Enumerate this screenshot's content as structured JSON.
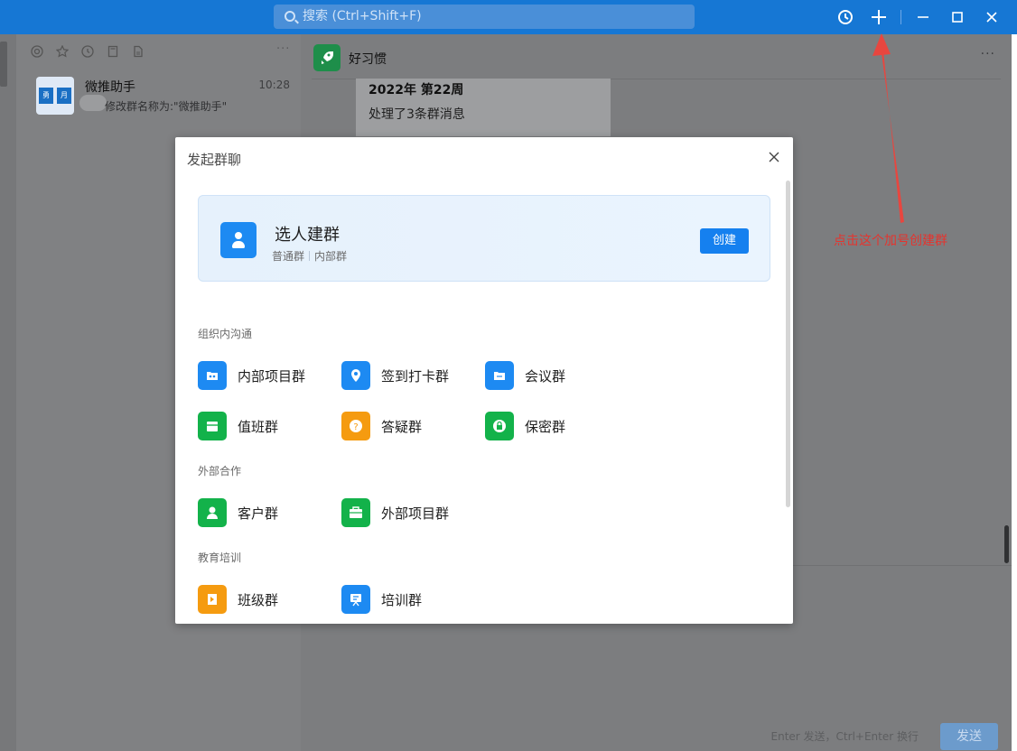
{
  "search": {
    "placeholder": "搜索 (Ctrl+Shift+F)"
  },
  "topbar_icons": [
    "history-icon",
    "plus-icon",
    "minimize-icon",
    "maximize-icon",
    "close-icon"
  ],
  "conversation_tabs": [
    "at-icon",
    "star-icon",
    "clock-icon",
    "bookmark-icon",
    "file-icon"
  ],
  "conversation": {
    "avatar_text": [
      "勇",
      "月"
    ],
    "name": "微推助手",
    "time": "10:28",
    "preview": "修改群名称为:\"微推助手\""
  },
  "chat": {
    "title": "好习惯",
    "card_title": "2022年 第22周",
    "card_body": "处理了3条群消息",
    "input_hint": "Enter 发送，Ctrl+Enter 换行",
    "send_label": "发送"
  },
  "annotation": "点击这个加号创建群",
  "modal": {
    "title": "发起群聊",
    "hero": {
      "title": "选人建群",
      "tag1": "普通群",
      "tag2": "内部群",
      "button": "创建"
    },
    "sections": [
      {
        "label": "组织内沟通",
        "items": [
          {
            "label": "内部项目群",
            "color": "#1d8af2",
            "icon": "folder-people-icon"
          },
          {
            "label": "签到打卡群",
            "color": "#1d8af2",
            "icon": "location-pin-icon"
          },
          {
            "label": "会议群",
            "color": "#1d8af2",
            "icon": "folder-icon"
          },
          {
            "label": "值班群",
            "color": "#13b24a",
            "icon": "calendar-icon"
          },
          {
            "label": "答疑群",
            "color": "#f59b10",
            "icon": "question-icon"
          },
          {
            "label": "保密群",
            "color": "#13b24a",
            "icon": "lock-icon"
          }
        ]
      },
      {
        "label": "外部合作",
        "items": [
          {
            "label": "客户群",
            "color": "#13b24a",
            "icon": "person-icon"
          },
          {
            "label": "外部项目群",
            "color": "#13b24a",
            "icon": "briefcase-icon"
          }
        ]
      },
      {
        "label": "教育培训",
        "items": [
          {
            "label": "班级群",
            "color": "#f59b10",
            "icon": "book-icon"
          },
          {
            "label": "培训群",
            "color": "#1d8af2",
            "icon": "presentation-icon"
          }
        ]
      }
    ]
  }
}
